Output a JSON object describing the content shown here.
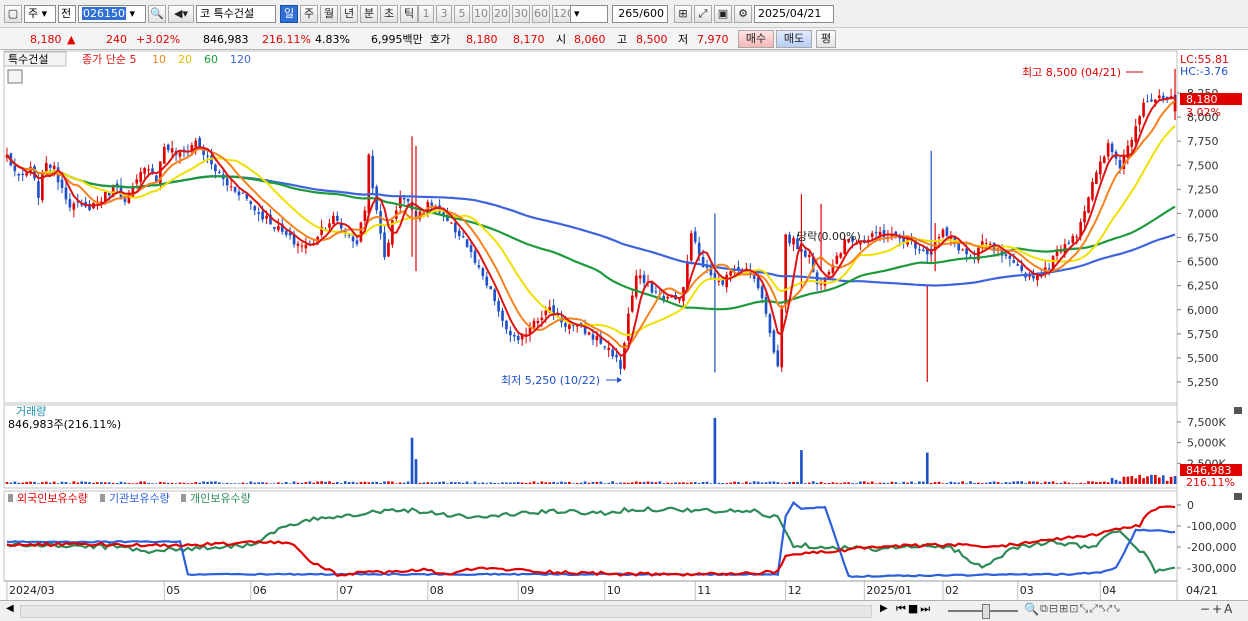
{
  "toolbar": {
    "market": "주",
    "range_mode": "전",
    "code": "026150",
    "stock_name": "특수건설",
    "market_badge": "코",
    "periods": [
      {
        "label": "일",
        "active": true
      },
      {
        "label": "주",
        "active": false
      },
      {
        "label": "월",
        "active": false
      },
      {
        "label": "년",
        "active": false
      },
      {
        "label": "분",
        "active": false
      },
      {
        "label": "초",
        "active": false
      },
      {
        "label": "틱",
        "active": false
      }
    ],
    "intervals": [
      "1",
      "3",
      "5",
      "10",
      "20",
      "30",
      "60",
      "120"
    ],
    "count": "265",
    "count_total": "/600",
    "date": "2025/04/21"
  },
  "quote": {
    "price": "8,180",
    "change_arrow": "▲",
    "change": "240",
    "change_pct": "+3.02%",
    "volume": "846,983",
    "volume_ratio": "216.11%",
    "turnover": "4.83%",
    "amount": "6,995백만",
    "ask_label": "호가",
    "ask1": "8,180",
    "ask2": "8,170",
    "open_label": "시",
    "open": "8,060",
    "high_label": "고",
    "high": "8,500",
    "low_label": "저",
    "low": "7,970",
    "buy_label": "매수",
    "sell_label": "매도",
    "even_label": "평"
  },
  "price_panel": {
    "name": "특수건설",
    "ma_legend": [
      "종가 단순 5",
      "10",
      "20",
      "60",
      "120"
    ],
    "lc_label": "LC:55.81",
    "hc_label": "HC:-3.76",
    "y_ticks": [
      "8,250",
      "8,000",
      "7,750",
      "7,500",
      "7,250",
      "7,000",
      "6,750",
      "6,500",
      "6,250",
      "6,000",
      "5,750",
      "5,500",
      "5,250"
    ],
    "high_annotation": "최고 8,500 (04/21)",
    "low_annotation": "최저 5,250 (10/22)",
    "mid_annotation": "당락(0.00%)",
    "price_badge": "8,180",
    "pct_badge": "3.02%"
  },
  "volume_panel": {
    "title": "거래량",
    "subtitle": "846,983주(216.11%)",
    "y_ticks": [
      "7,500K",
      "5,000K",
      "2,500K"
    ],
    "value_badge": "846,983",
    "pct_badge": "216.11%"
  },
  "holding_panel": {
    "legend": [
      "외국인보유수량",
      "기관보유수량",
      "개인보유수량"
    ],
    "y_ticks": [
      "0",
      "-100,000",
      "-200,000",
      "-300,000"
    ]
  },
  "x_axis": {
    "labels": [
      "2024/03",
      "05",
      "06",
      "07",
      "08",
      "09",
      "10",
      "11",
      "12",
      "2025/01",
      "02",
      "03",
      "04",
      "04/21"
    ]
  },
  "colors": {
    "up": "#e00000",
    "down": "#1e50c8",
    "ma5": "#dc1414",
    "ma10": "#f5821f",
    "ma20": "#f0e000",
    "ma60": "#1e9a3c",
    "ma120": "#3c64dc",
    "foreign": "#e00000",
    "institution": "#2c5fdc",
    "individual": "#2e8b57"
  },
  "chart_data": {
    "type": "candlestick",
    "x_range": [
      "2024/03",
      "2025/04/21"
    ],
    "ylim": [
      5100,
      8550
    ],
    "volume_ylim": [
      0,
      8500
    ],
    "holding_ylim": [
      -350000,
      30000
    ],
    "price_anchors": [
      [
        0,
        7600
      ],
      [
        3,
        7350
      ],
      [
        6,
        7450
      ],
      [
        8,
        7200
      ],
      [
        10,
        7550
      ],
      [
        12,
        7450
      ],
      [
        16,
        7100
      ],
      [
        20,
        7050
      ],
      [
        24,
        7150
      ],
      [
        28,
        7300
      ],
      [
        30,
        7100
      ],
      [
        34,
        7400
      ],
      [
        36,
        7500
      ],
      [
        38,
        7350
      ],
      [
        40,
        7700
      ],
      [
        44,
        7600
      ],
      [
        48,
        7750
      ],
      [
        52,
        7500
      ],
      [
        56,
        7300
      ],
      [
        60,
        7200
      ],
      [
        64,
        7000
      ],
      [
        66,
        6950
      ],
      [
        70,
        6800
      ],
      [
        73,
        6700
      ],
      [
        77,
        6650
      ],
      [
        80,
        6850
      ],
      [
        83,
        6950
      ],
      [
        86,
        6800
      ],
      [
        89,
        6700
      ],
      [
        91,
        7050
      ],
      [
        92,
        7600
      ],
      [
        94,
        7000
      ],
      [
        96,
        6550
      ],
      [
        98,
        6900
      ],
      [
        100,
        7200
      ],
      [
        104,
        7000
      ],
      [
        108,
        7100
      ],
      [
        112,
        6900
      ],
      [
        116,
        6750
      ],
      [
        120,
        6400
      ],
      [
        124,
        6100
      ],
      [
        126,
        5850
      ],
      [
        130,
        5650
      ],
      [
        134,
        5900
      ],
      [
        138,
        6000
      ],
      [
        142,
        5850
      ],
      [
        146,
        5800
      ],
      [
        150,
        5700
      ],
      [
        154,
        5550
      ],
      [
        156,
        5400
      ],
      [
        158,
        5950
      ],
      [
        160,
        6350
      ],
      [
        163,
        6250
      ],
      [
        166,
        6150
      ],
      [
        170,
        6100
      ],
      [
        172,
        6200
      ],
      [
        174,
        6800
      ],
      [
        176,
        6550
      ],
      [
        178,
        6400
      ],
      [
        182,
        6300
      ],
      [
        186,
        6450
      ],
      [
        190,
        6350
      ],
      [
        192,
        6150
      ],
      [
        194,
        5750
      ],
      [
        196,
        5400
      ],
      [
        197,
        6050
      ],
      [
        198,
        6750
      ],
      [
        200,
        6700
      ],
      [
        204,
        6550
      ],
      [
        206,
        6250
      ],
      [
        210,
        6500
      ],
      [
        214,
        6750
      ],
      [
        218,
        6700
      ],
      [
        222,
        6800
      ],
      [
        226,
        6750
      ],
      [
        230,
        6700
      ],
      [
        234,
        6600
      ],
      [
        238,
        6800
      ],
      [
        242,
        6650
      ],
      [
        246,
        6500
      ],
      [
        248,
        6700
      ],
      [
        252,
        6600
      ],
      [
        256,
        6450
      ],
      [
        260,
        6350
      ],
      [
        264,
        6400
      ],
      [
        268,
        6650
      ],
      [
        272,
        6800
      ],
      [
        276,
        7300
      ],
      [
        280,
        7700
      ],
      [
        283,
        7500
      ],
      [
        286,
        7800
      ],
      [
        289,
        8180
      ]
    ],
    "daily_candles": [
      {
        "day": "04/21",
        "open": 8060,
        "high": 8500,
        "low": 7970,
        "close": 8180
      }
    ],
    "extremes": {
      "high": {
        "value": 8500,
        "date": "04/21"
      },
      "low": {
        "value": 5250,
        "date": "10/22"
      }
    },
    "volume_spikes": [
      [
        103,
        5600
      ],
      [
        104,
        3000
      ],
      [
        180,
        8000
      ],
      [
        202,
        4100
      ],
      [
        234,
        3800
      ]
    ],
    "volume_last": 846983,
    "foreign_anchors": [
      [
        0,
        -190000
      ],
      [
        20,
        -185000
      ],
      [
        40,
        -195000
      ],
      [
        60,
        -180000
      ],
      [
        72,
        -180000
      ],
      [
        78,
        -280000
      ],
      [
        84,
        -330000
      ],
      [
        96,
        -320000
      ],
      [
        106,
        -310000
      ],
      [
        112,
        -330000
      ],
      [
        120,
        -300000
      ],
      [
        140,
        -320000
      ],
      [
        160,
        -330000
      ],
      [
        180,
        -330000
      ],
      [
        196,
        -320000
      ],
      [
        198,
        -240000
      ],
      [
        210,
        -220000
      ],
      [
        220,
        -200000
      ],
      [
        240,
        -190000
      ],
      [
        252,
        -200000
      ],
      [
        262,
        -170000
      ],
      [
        274,
        -150000
      ],
      [
        282,
        -120000
      ],
      [
        288,
        -100000
      ],
      [
        290,
        -40000
      ],
      [
        292,
        -20000
      ],
      [
        296,
        -5000
      ]
    ],
    "institution_anchors": [
      [
        0,
        -175000
      ],
      [
        44,
        -175000
      ],
      [
        46,
        -330000
      ],
      [
        196,
        -330000
      ],
      [
        198,
        -50000
      ],
      [
        200,
        10000
      ],
      [
        202,
        -20000
      ],
      [
        208,
        -10000
      ],
      [
        214,
        -340000
      ],
      [
        260,
        -330000
      ],
      [
        270,
        -330000
      ],
      [
        278,
        -320000
      ],
      [
        282,
        -300000
      ],
      [
        287,
        -120000
      ],
      [
        293,
        -120000
      ],
      [
        296,
        -130000
      ]
    ],
    "individual_anchors": [
      [
        0,
        -190000
      ],
      [
        30,
        -200000
      ],
      [
        36,
        -220000
      ],
      [
        44,
        -210000
      ],
      [
        62,
        -190000
      ],
      [
        70,
        -110000
      ],
      [
        80,
        -60000
      ],
      [
        90,
        -40000
      ],
      [
        100,
        -20000
      ],
      [
        110,
        -40000
      ],
      [
        120,
        -60000
      ],
      [
        130,
        -40000
      ],
      [
        140,
        -30000
      ],
      [
        150,
        -40000
      ],
      [
        160,
        -20000
      ],
      [
        170,
        -20000
      ],
      [
        180,
        -30000
      ],
      [
        190,
        -30000
      ],
      [
        196,
        -60000
      ],
      [
        200,
        -190000
      ],
      [
        210,
        -200000
      ],
      [
        220,
        -210000
      ],
      [
        230,
        -200000
      ],
      [
        240,
        -200000
      ],
      [
        248,
        -300000
      ],
      [
        256,
        -200000
      ],
      [
        266,
        -180000
      ],
      [
        276,
        -200000
      ],
      [
        282,
        -120000
      ],
      [
        286,
        -180000
      ],
      [
        290,
        -250000
      ],
      [
        292,
        -320000
      ],
      [
        296,
        -300000
      ]
    ]
  }
}
